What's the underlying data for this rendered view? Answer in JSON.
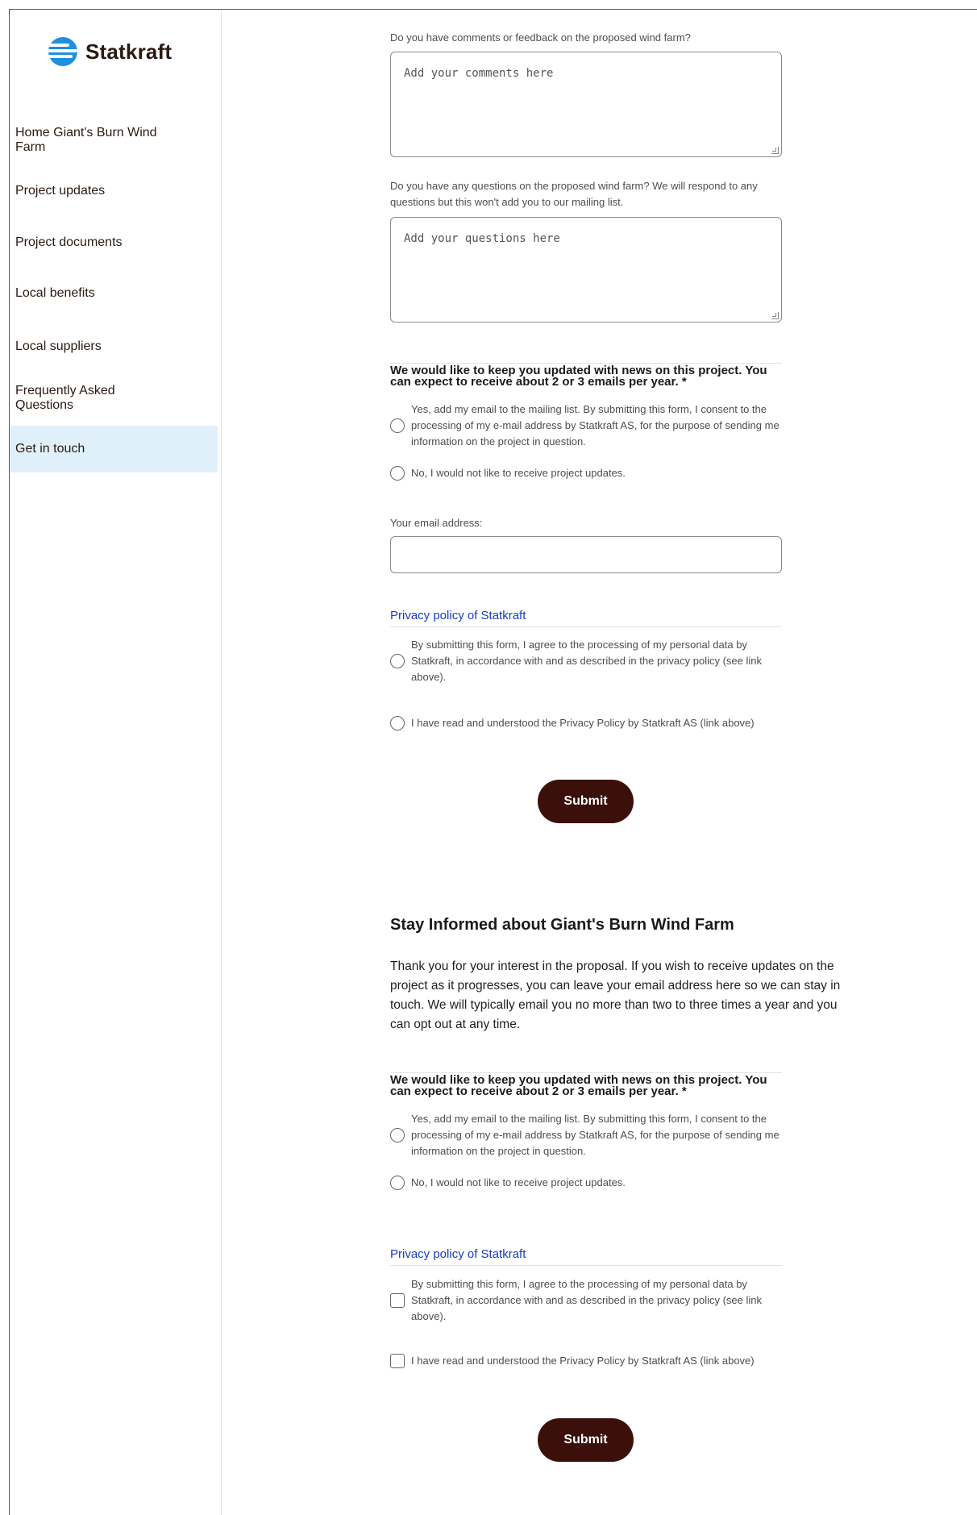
{
  "brand": {
    "name": "Statkraft",
    "color": "#1e90e0"
  },
  "sidebar": {
    "items": [
      {
        "label": "Home Giant's Burn Wind Farm"
      },
      {
        "label": "Project updates"
      },
      {
        "label": "Project documents"
      },
      {
        "label": "Local benefits"
      },
      {
        "label": "Local suppliers"
      },
      {
        "label": "Frequently Asked Questions"
      },
      {
        "label": "Get in touch",
        "active": true
      }
    ]
  },
  "form1": {
    "comments_label": "Do you have comments or feedback on the proposed wind farm?",
    "comments_placeholder": "Add your comments here",
    "questions_label": "Do you have any questions on the proposed wind farm? We will respond to any questions but this won't add you to our mailing list.",
    "questions_placeholder": "Add your questions here",
    "updates_title": "We would like to keep you updated with news on this project. You can expect to receive about 2 or 3 emails per year. *",
    "opt_yes": "Yes, add my email to the mailing list. By submitting this form, I consent to the processing of my e-mail address by Statkraft AS, for the purpose of sending me information on the project in question.",
    "opt_no": "No, I would not like to receive project updates.",
    "email_label": "Your email address:",
    "email_value": "",
    "privacy_link": "Privacy policy of Statkraft",
    "consent_processing": "By submitting this form, I agree to the processing of my personal data by Statkraft, in accordance with and as described in the privacy policy (see link above).",
    "consent_read": "I have read and understood the Privacy Policy by Statkraft AS (link above)",
    "submit": "Submit"
  },
  "form2": {
    "title": "Stay Informed about Giant's Burn Wind Farm",
    "intro": "Thank you for your interest in the proposal. If you wish to receive updates on the project as it progresses, you can leave your email address here so we can stay in touch. We will typically email you no more than two to three times a year and you can opt out at any time.",
    "updates_title": "We would like to keep you updated with news on this project. You can expect to receive about 2 or 3 emails per year. *",
    "opt_yes": "Yes, add my email to the mailing list. By submitting this form, I consent to the processing of my e-mail address by Statkraft AS, for the purpose of sending me information on the project in question.",
    "opt_no": "No, I would not like to receive project updates.",
    "privacy_link": "Privacy policy of Statkraft",
    "consent_processing": "By submitting this form, I agree to the processing of my personal data by Statkraft, in accordance with and as described in the privacy policy (see link above).",
    "consent_read": "I have read and understood the Privacy Policy by Statkraft AS (link above)",
    "submit": "Submit"
  },
  "colors": {
    "submit_bg": "#3b0f0a",
    "active_nav_bg": "#dff0fb",
    "link": "#1a3dbf"
  }
}
